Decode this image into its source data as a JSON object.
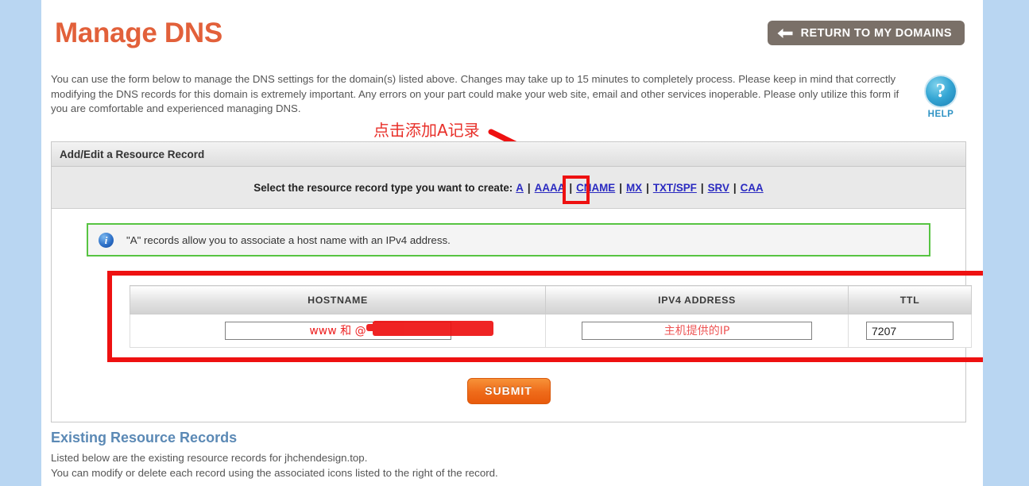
{
  "header": {
    "title": "Manage DNS",
    "return_button": "RETURN TO MY DOMAINS",
    "return_icon": "arrow-left-icon"
  },
  "intro": {
    "text": "You can use the form below to manage the DNS settings for the domain(s) listed above. Changes may take up to 15 minutes to completely process. Please keep in mind that correctly modifying the DNS records for this domain is extremely important. Any errors on your part could make your web site, email and other services inoperable. Please only utilize this form if you are comfortable and experienced managing DNS."
  },
  "help": {
    "icon": "question-mark-icon",
    "glyph": "?",
    "label": "HELP"
  },
  "annotations": {
    "cn_note": "点击添加A记录",
    "arrow": "red-arrow-pointing-to-a-link",
    "highlight_color": "#ee1111",
    "redaction": "red-scribble-redaction"
  },
  "panel": {
    "heading": "Add/Edit a Resource Record",
    "type_selector": {
      "label": "Select the resource record type you want to create:",
      "options": [
        "A",
        "AAAA",
        "CNAME",
        "MX",
        "TXT/SPF",
        "SRV",
        "CAA"
      ],
      "selected": "A",
      "separator": "|"
    },
    "info": {
      "icon": "info-icon",
      "glyph": "i",
      "text": "\"A\" records allow you to associate a host name with an IPv4 address.",
      "border_color": "#57c442"
    },
    "table": {
      "columns": [
        "HOSTNAME",
        "IPV4 ADDRESS",
        "TTL"
      ],
      "row": {
        "hostname": "www 和 @",
        "ipv4": "主机提供的IP",
        "ttl": "7207"
      }
    },
    "submit_label": "SUBMIT"
  },
  "existing": {
    "heading": "Existing Resource Records",
    "line1": "Listed below are the existing resource records for jhchendesign.top.",
    "line2": "You can modify or delete each record using the associated icons listed to the right of the record."
  }
}
